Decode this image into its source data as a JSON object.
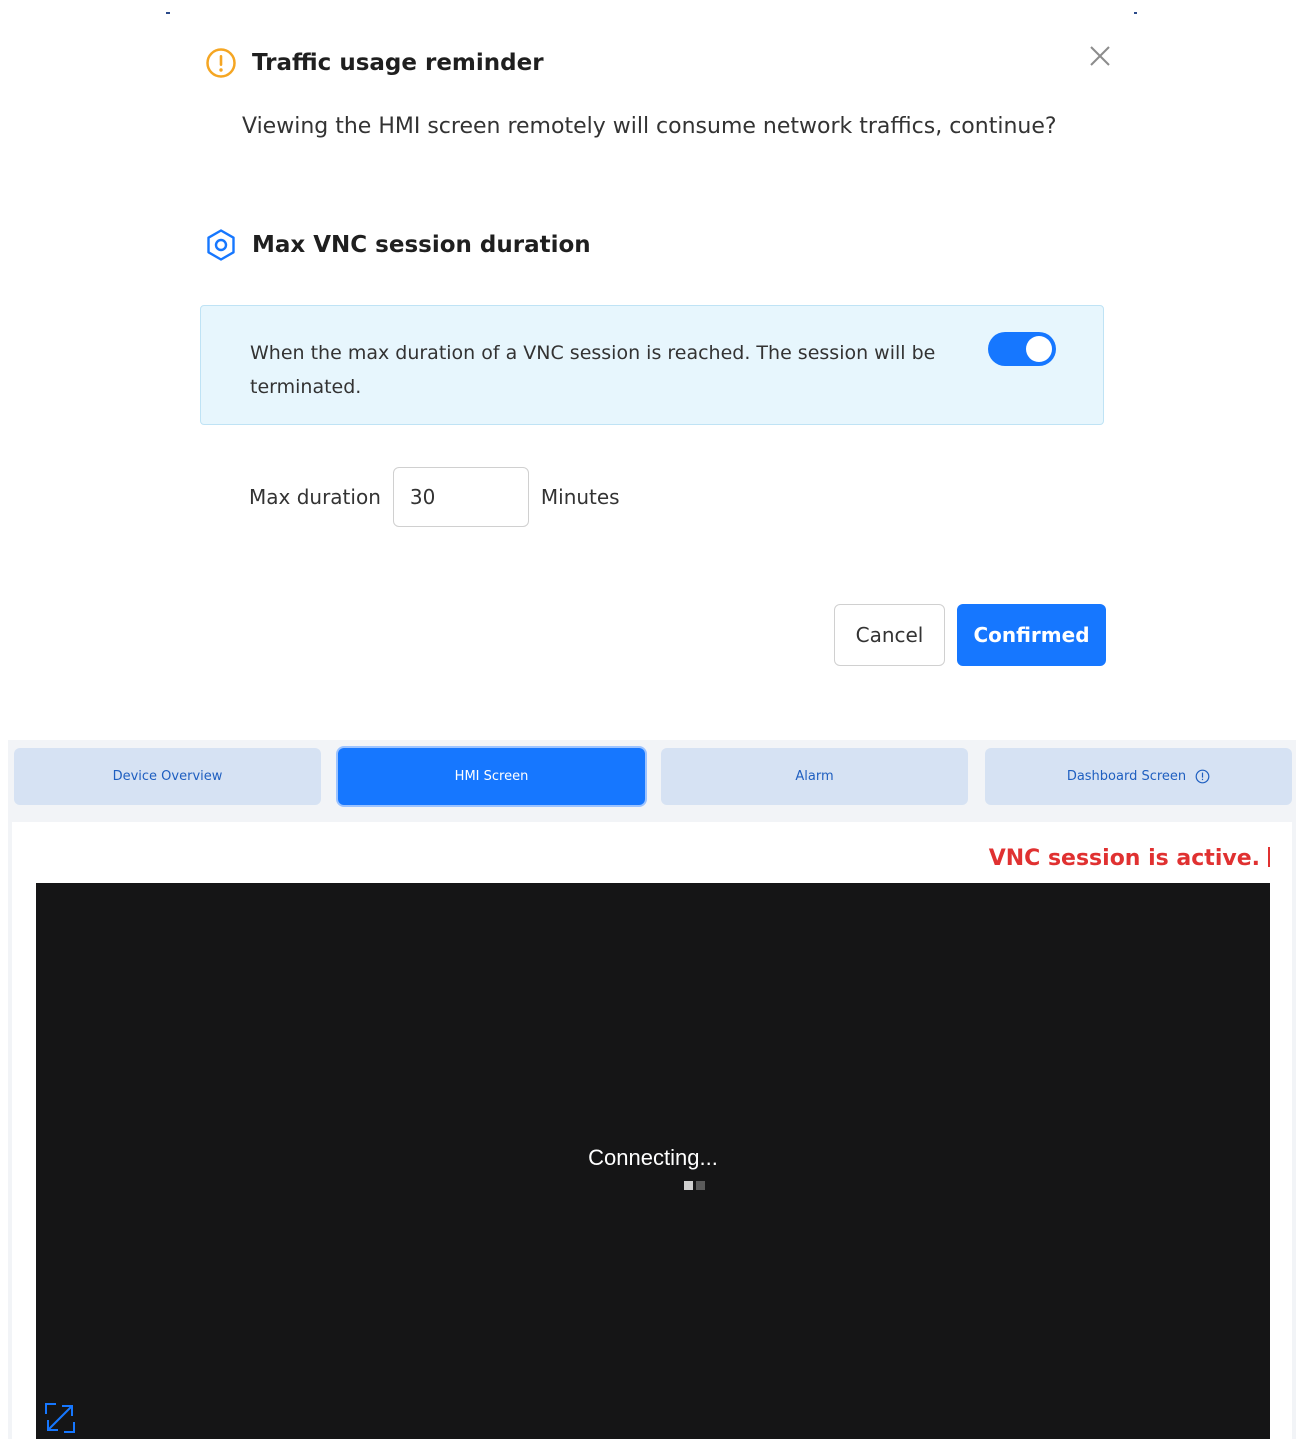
{
  "dialog": {
    "title": "Traffic usage reminder",
    "message": "Viewing the HMI screen remotely will consume network traffics, continue?",
    "vnc_section_title": "Max VNC session duration",
    "info_text": "When the max duration of a VNC session is reached. The session will be terminated.",
    "toggle_on": true,
    "max_duration_label": "Max duration",
    "max_duration_value": "30",
    "unit_label": "Minutes",
    "cancel_label": "Cancel",
    "confirm_label": "Confirmed",
    "icons": {
      "warning": "warning-circle-icon",
      "settings": "hexagon-settings-icon",
      "close": "close-icon"
    },
    "colors": {
      "warning": "#f5a623",
      "accent": "#1677ff",
      "info_bg": "#e7f6fd"
    }
  },
  "tabs": [
    {
      "label": "Device Overview",
      "active": false
    },
    {
      "label": "HMI Screen",
      "active": true
    },
    {
      "label": "Alarm",
      "active": false
    },
    {
      "label": "Dashboard Screen",
      "active": false
    }
  ],
  "vnc": {
    "status_text": "VNC session is active.",
    "connecting_text": "Connecting...",
    "status_color": "#e03131"
  }
}
